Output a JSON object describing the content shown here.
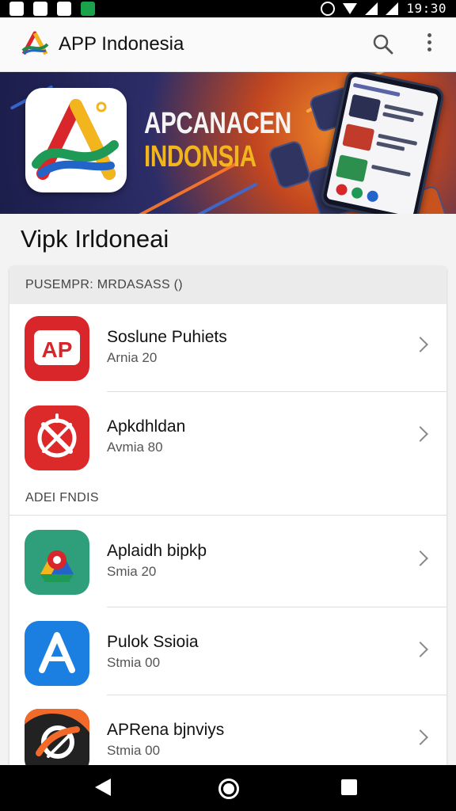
{
  "status_bar": {
    "time": "19:30"
  },
  "app_bar": {
    "title": "APP Indonesia"
  },
  "banner": {
    "line1": "APCANACEN",
    "line2": "INDONSIA"
  },
  "section_title": "Vipk Irldoneai",
  "categories": [
    {
      "header": "PUSEMPR: MRDASASS ()",
      "apps": [
        {
          "name": "Soslune Puhiets",
          "subtitle": "Arnia 20",
          "icon": "ap-red-icon"
        },
        {
          "name": "Apkdhldan",
          "subtitle": "Avmia 80",
          "icon": "red-compass-icon"
        }
      ]
    },
    {
      "header": "ADEI FNDIS",
      "apps": [
        {
          "name": "Aplaidh bipkþ",
          "subtitle": "Smia 20",
          "icon": "green-drive-icon"
        },
        {
          "name": "Pulok Ssioia",
          "subtitle": "Stmia 00",
          "icon": "blue-a-icon"
        },
        {
          "name": "APRena bjnviys",
          "subtitle": "Stmia 00",
          "icon": "orange-swirl-icon"
        }
      ]
    }
  ],
  "colors": {
    "accent_red": "#d9262b",
    "banner_yellow": "#f2b51d",
    "banner_navy": "#1b1d4a"
  }
}
